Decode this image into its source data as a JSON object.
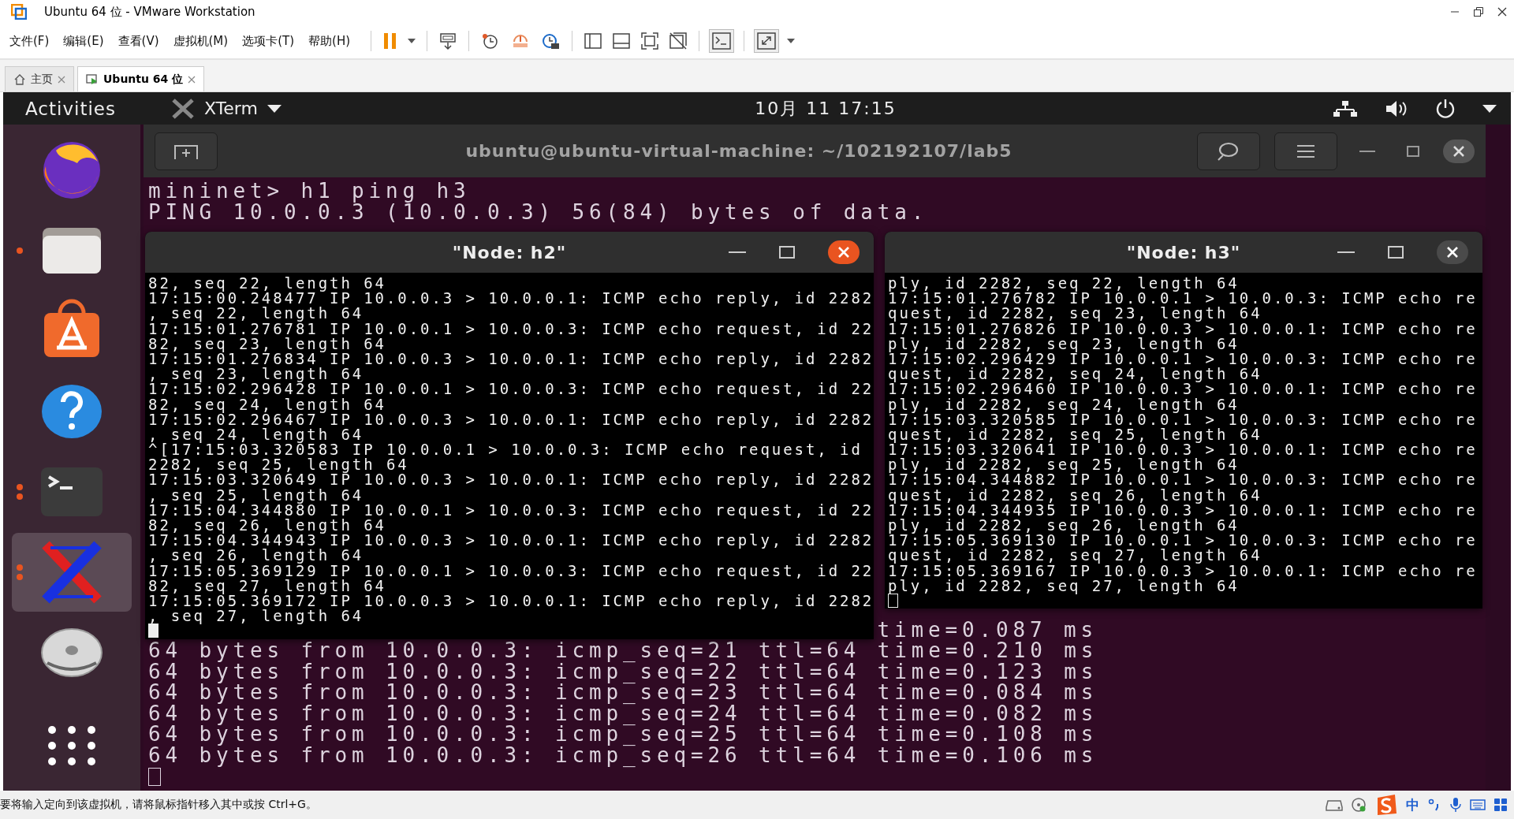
{
  "window": {
    "title": "Ubuntu 64 位 - VMware Workstation"
  },
  "menu": [
    "文件(F)",
    "编辑(E)",
    "查看(V)",
    "虚拟机(M)",
    "选项卡(T)",
    "帮助(H)"
  ],
  "tabs": [
    {
      "label": "主页",
      "selected": false
    },
    {
      "label": "Ubuntu 64 位",
      "selected": true
    }
  ],
  "top_bar": {
    "activities": "Activities",
    "app": "XTerm",
    "clock": "10月 11 17:15"
  },
  "dock": {
    "items": [
      {
        "kind": "browser",
        "running": false,
        "selected": false
      },
      {
        "kind": "files",
        "running": true,
        "multiple_windows": false,
        "selected": false
      },
      {
        "kind": "software",
        "running": false,
        "selected": false
      },
      {
        "kind": "help",
        "running": false,
        "selected": false
      },
      {
        "kind": "terminal",
        "running": true,
        "multiple_windows": true,
        "selected": false
      },
      {
        "kind": "xterm",
        "running": true,
        "multiple_windows": true,
        "selected": true
      },
      {
        "kind": "dvd",
        "running": false,
        "selected": false
      },
      {
        "kind": "apps",
        "running": false,
        "selected": false
      }
    ]
  },
  "terminal": {
    "title": "ubuntu@ubuntu-virtual-machine: ~/102192107/lab5",
    "top_lines": [
      "mininet> h1 ping h3",
      "PING 10.0.0.3 (10.0.0.3) 56(84) bytes of data."
    ],
    "partial_line": "time=0.087 ms",
    "bottom_lines": [
      "64 bytes from 10.0.0.3: icmp_seq=21 ttl=64 time=0.210 ms",
      "64 bytes from 10.0.0.3: icmp_seq=22 ttl=64 time=0.123 ms",
      "64 bytes from 10.0.0.3: icmp_seq=23 ttl=64 time=0.084 ms",
      "64 bytes from 10.0.0.3: icmp_seq=24 ttl=64 time=0.082 ms",
      "64 bytes from 10.0.0.3: icmp_seq=25 ttl=64 time=0.108 ms",
      "64 bytes from 10.0.0.3: icmp_seq=26 ttl=64 time=0.106 ms"
    ]
  },
  "node_windows": [
    {
      "title": "\"Node: h2\"",
      "focused": true,
      "lines": [
        "82, seq 22, length 64",
        "17:15:00.248477 IP 10.0.0.3 > 10.0.0.1: ICMP echo reply, id 2282",
        ", seq 22, length 64",
        "17:15:01.276781 IP 10.0.0.1 > 10.0.0.3: ICMP echo request, id 22",
        "82, seq 23, length 64",
        "17:15:01.276834 IP 10.0.0.3 > 10.0.0.1: ICMP echo reply, id 2282",
        ", seq 23, length 64",
        "17:15:02.296428 IP 10.0.0.1 > 10.0.0.3: ICMP echo request, id 22",
        "82, seq 24, length 64",
        "17:15:02.296467 IP 10.0.0.3 > 10.0.0.1: ICMP echo reply, id 2282",
        ", seq 24, length 64",
        "^[17:15:03.320583 IP 10.0.0.1 > 10.0.0.3: ICMP echo request, id",
        "2282, seq 25, length 64",
        "17:15:03.320649 IP 10.0.0.3 > 10.0.0.1: ICMP echo reply, id 2282",
        ", seq 25, length 64",
        "17:15:04.344880 IP 10.0.0.1 > 10.0.0.3: ICMP echo request, id 22",
        "82, seq 26, length 64",
        "17:15:04.344943 IP 10.0.0.3 > 10.0.0.1: ICMP echo reply, id 2282",
        ", seq 26, length 64",
        "17:15:05.369129 IP 10.0.0.1 > 10.0.0.3: ICMP echo request, id 22",
        "82, seq 27, length 64",
        "17:15:05.369172 IP 10.0.0.3 > 10.0.0.1: ICMP echo reply, id 2282",
        ", seq 27, length 64"
      ]
    },
    {
      "title": "\"Node: h3\"",
      "focused": false,
      "lines": [
        "ply, id 2282, seq 22, length 64",
        "17:15:01.276782 IP 10.0.0.1 > 10.0.0.3: ICMP echo re",
        "quest, id 2282, seq 23, length 64",
        "17:15:01.276826 IP 10.0.0.3 > 10.0.0.1: ICMP echo re",
        "ply, id 2282, seq 23, length 64",
        "17:15:02.296429 IP 10.0.0.1 > 10.0.0.3: ICMP echo re",
        "quest, id 2282, seq 24, length 64",
        "17:15:02.296460 IP 10.0.0.3 > 10.0.0.1: ICMP echo re",
        "ply, id 2282, seq 24, length 64",
        "17:15:03.320585 IP 10.0.0.1 > 10.0.0.3: ICMP echo re",
        "quest, id 2282, seq 25, length 64",
        "17:15:03.320641 IP 10.0.0.3 > 10.0.0.1: ICMP echo re",
        "ply, id 2282, seq 25, length 64",
        "17:15:04.344882 IP 10.0.0.1 > 10.0.0.3: ICMP echo re",
        "quest, id 2282, seq 26, length 64",
        "17:15:04.344935 IP 10.0.0.3 > 10.0.0.1: ICMP echo re",
        "ply, id 2282, seq 26, length 64",
        "17:15:05.369130 IP 10.0.0.1 > 10.0.0.3: ICMP echo re",
        "quest, id 2282, seq 27, length 64",
        "17:15:05.369167 IP 10.0.0.3 > 10.0.0.1: ICMP echo re",
        "ply, id 2282, seq 27, length 64"
      ]
    }
  ],
  "status_bar": {
    "message": "要将输入定向到该虚拟机，请将鼠标指针移入其中或按 Ctrl+G。",
    "ime_mode": "中"
  }
}
